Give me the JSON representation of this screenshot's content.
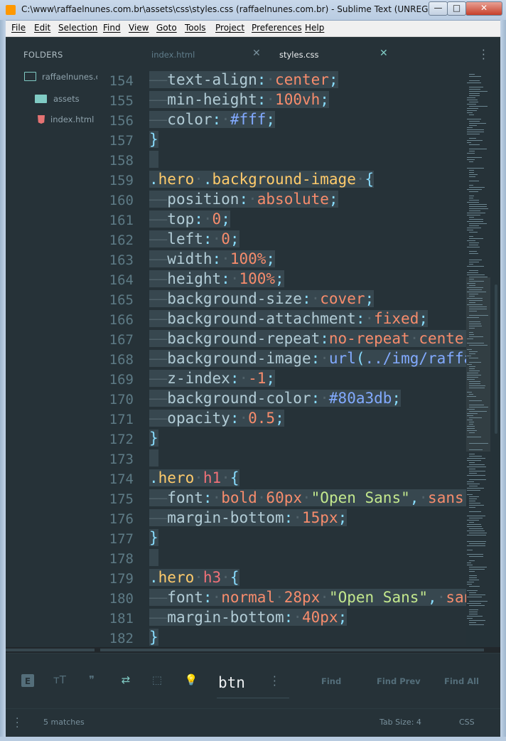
{
  "window": {
    "title": "C:\\www\\raffaelnunes.com.br\\assets\\css\\styles.css (raffaelnunes.com.br) - Sublime Text (UNREGISTERED)",
    "minimize": "—",
    "maximize": "□",
    "close": "✕"
  },
  "menu": [
    "File",
    "Edit",
    "Selection",
    "Find",
    "View",
    "Goto",
    "Tools",
    "Project",
    "Preferences",
    "Help"
  ],
  "sidebar": {
    "header": "FOLDERS",
    "project": "raffaelnunes.com.br",
    "items": [
      {
        "label": "assets",
        "icon": "folder-icon"
      },
      {
        "label": "index.html",
        "icon": "html5-icon"
      }
    ]
  },
  "tabs": [
    {
      "label": "index.html",
      "active": false,
      "close": "✕"
    },
    {
      "label": "styles.css",
      "active": true,
      "close": "✕"
    }
  ],
  "editor": {
    "line_numbers": [
      "154",
      "155",
      "156",
      "157",
      "158",
      "159",
      "160",
      "161",
      "162",
      "163",
      "164",
      "165",
      "166",
      "167",
      "168",
      "169",
      "170",
      "171",
      "172",
      "173",
      "174",
      "175",
      "176",
      "177",
      "178",
      "179",
      "180",
      "181",
      "182"
    ]
  },
  "find_panel": {
    "toggles": [
      {
        "name": "regex",
        "label": "E"
      },
      {
        "name": "case",
        "label": "ᴛT"
      },
      {
        "name": "whole-word",
        "label": "❞"
      },
      {
        "name": "wrap",
        "label": "⇄"
      },
      {
        "name": "in-selection",
        "label": "⬚"
      },
      {
        "name": "highlight",
        "label": "💡"
      }
    ],
    "query": "btn",
    "find_label": "Find",
    "find_prev_label": "Find Prev",
    "find_all_label": "Find All"
  },
  "status": {
    "matches": "5 matches",
    "tab_size": "Tab Size: 4",
    "syntax": "CSS"
  },
  "colors": {
    "background": "#263238",
    "accent": "#80cbc4",
    "property": "#b2ccd6",
    "value": "#f78c6c",
    "class": "#ffcb6b",
    "tag": "#f07178",
    "string": "#c3e88d",
    "function": "#82aaff"
  }
}
